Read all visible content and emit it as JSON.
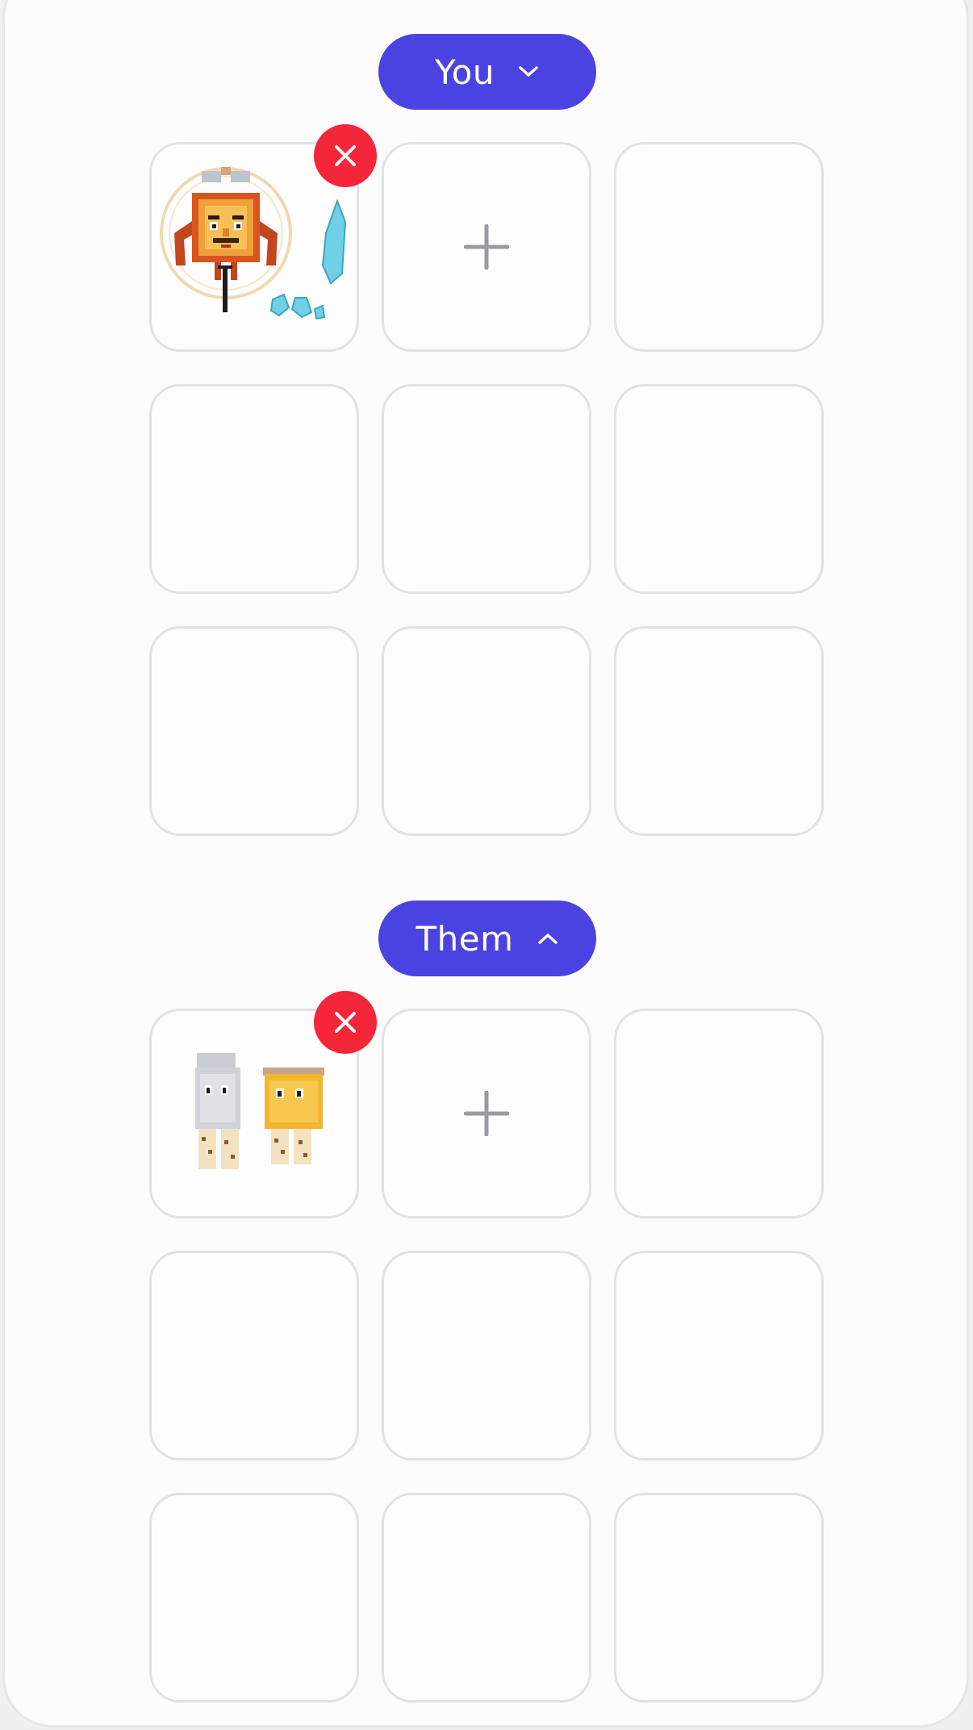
{
  "you_section": {
    "toggle_label": "You",
    "toggle_icon": "chevron-down-icon",
    "slot_count": 9
  },
  "them_section": {
    "toggle_label": "Them",
    "toggle_icon": "chevron-up-icon",
    "slot_count": 9
  },
  "colors": {
    "accent": "#4a43e1",
    "remove": "#f4263a",
    "plus": "#9a9aa2",
    "slot_border": "#e2e2e2"
  }
}
